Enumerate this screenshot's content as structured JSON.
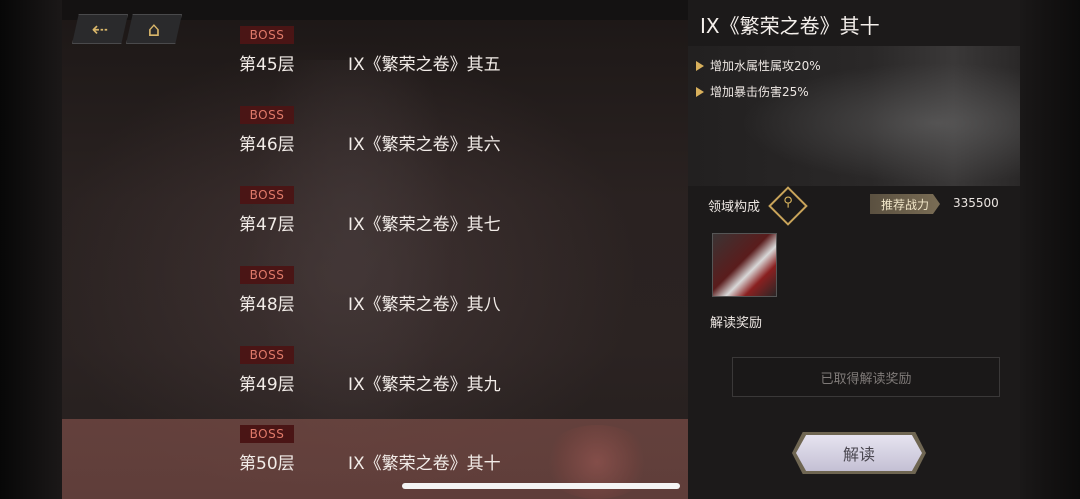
{
  "nav": {
    "back_icon": "back-arrow-icon",
    "home_icon": "home-icon"
  },
  "floors": [
    {
      "tag": "BOSS",
      "floor": "第45层",
      "name": "IX《繁荣之卷》其五"
    },
    {
      "tag": "BOSS",
      "floor": "第46层",
      "name": "IX《繁荣之卷》其六"
    },
    {
      "tag": "BOSS",
      "floor": "第47层",
      "name": "IX《繁荣之卷》其七"
    },
    {
      "tag": "BOSS",
      "floor": "第48层",
      "name": "IX《繁荣之卷》其八"
    },
    {
      "tag": "BOSS",
      "floor": "第49层",
      "name": "IX《繁荣之卷》其九"
    },
    {
      "tag": "BOSS",
      "floor": "第50层",
      "name": "IX《繁荣之卷》其十",
      "selected": true
    }
  ],
  "detail": {
    "title": "IX《繁荣之卷》其十",
    "buffs": [
      "增加水属性属攻20%",
      "增加暴击伤害25%"
    ],
    "domain_label": "领域构成",
    "power_label": "推荐战力",
    "power_value": "335500",
    "reward_label": "解读奖励",
    "claimed_text": "已取得解读奖励",
    "start_label": "解读"
  },
  "colors": {
    "accent_gold": "#d8b05c",
    "boss_tag_bg": "#4a1515",
    "boss_tag_text": "#e07a6a",
    "selected_row": "#7a4a45"
  }
}
